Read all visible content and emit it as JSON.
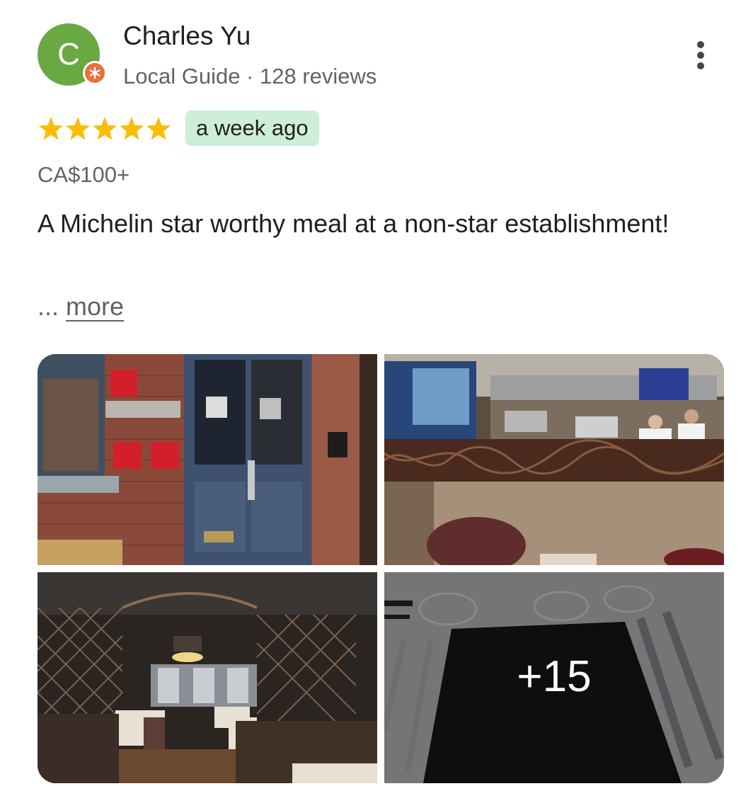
{
  "review": {
    "reviewer": {
      "initial": "C",
      "name": "Charles Yu",
      "meta": "Local Guide · 128 reviews",
      "avatar_color": "#6aa842",
      "badge_icon": "local-guide-star-icon",
      "badge_color": "#e8703a"
    },
    "rating": 5,
    "rating_max": 5,
    "star_color": "#fbbc04",
    "date": "a week ago",
    "date_chip_color": "#cdeed8",
    "price": "CA$100+",
    "text": "A Michelin star worthy meal at a non-star establishment!",
    "ellipsis": "...",
    "more_label": "more",
    "menu_icon": "more-vert-icon"
  },
  "photos": {
    "items": [
      {
        "subject": "restaurant-entrance"
      },
      {
        "subject": "open-kitchen"
      },
      {
        "subject": "dining-room"
      },
      {
        "subject": "table-setting"
      }
    ],
    "extra_count_label": "+15"
  }
}
